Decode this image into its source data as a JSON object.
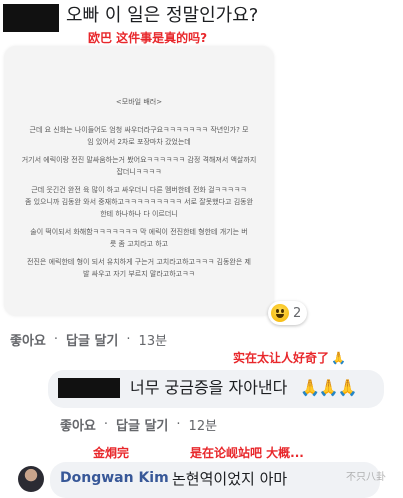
{
  "comment1": {
    "text": "오빠 이 일은 정말인가요?",
    "translation": "欧巴 这件事是真的吗?",
    "post": {
      "heading": "<모바일 배러>",
      "lines": [
        "근데 요 신화는 나이들어도 엄청 싸우더라구요ㅋㅋㅋㅋㅋㅋㅋ 작년인가? 모",
        "임 있어서 2차로 포장마차 갔었는데",
        "거기서 에릭이랑 전진 말싸움하는거 봤어요ㅋㅋㅋㅋㅋㅋ 감정 격해져서 액살까지",
        "잡더니ㅋㅋㅋㅋ",
        "근데 웃긴건 완전 육 많이 하고 싸우더니 다른 멤버한테 전화 걸ㅋㅋㅋㅋㅋ",
        "좀 있으니까 김동완 와서 중재하고ㅋㅋㅋㅋㅋㅋㅋㅋㅋ 서로 잘못했다고 김동완",
        "한테 하나하나 다 이르더니",
        "술이 떡이되서 화해함ㅋㅋㅋㅋㅋㅋㅋ 막 에릭이 전진한테 형한테 개기는 버",
        "릇 좀 고치라고 하고",
        "전진은 에릭한테 형이 되서 유치하게 구는거 고치라고하고ㅋㅋㅋ 김동완은 제",
        "발 싸우고 자기 부르지 말라고하고ㅋㅋ"
      ]
    },
    "reaction_count": "2",
    "like_label": "좋아요",
    "reply_label": "답글 달기",
    "time": "13분"
  },
  "reply1": {
    "annotation": "实在太让人好奇了",
    "text": "너무 궁금증을 자아낸다",
    "like_label": "좋아요",
    "reply_label": "답글 달기",
    "time": "12분"
  },
  "reply2": {
    "name_annotation": "金烔完",
    "annotation": "是在论岘站吧 大概...",
    "author": "Dongwan Kim",
    "text": "논현역이었지 아마",
    "watermark": "不只八卦"
  },
  "colors": {
    "annotation_red": "#e8272b",
    "bubble": "#f0f2f5",
    "meta_gray": "#65676b",
    "author_blue": "#385898"
  }
}
